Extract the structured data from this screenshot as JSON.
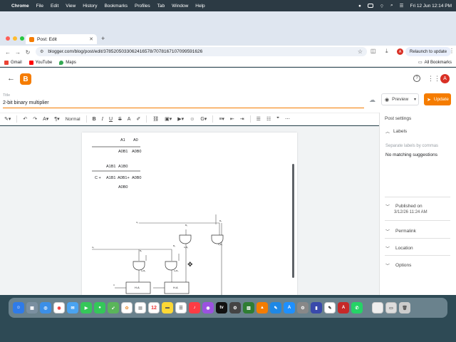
{
  "menubar": {
    "apple": "",
    "items": [
      "Chrome",
      "File",
      "Edit",
      "View",
      "History",
      "Bookmarks",
      "Profiles",
      "Tab",
      "Window",
      "Help"
    ],
    "clock": "Fri 12 Jun  12:14 PM"
  },
  "browser": {
    "tab_title": "Post: Edit",
    "url": "blogger.com/blog/post/edit/3785205033062416578/7078167107099591626",
    "relaunch": "Relaunch to update",
    "avatar_letter": "A",
    "bookmarks": [
      {
        "label": "Gmail"
      },
      {
        "label": "YouTube"
      },
      {
        "label": "Maps"
      }
    ],
    "all_bookmarks": "All Bookmarks"
  },
  "blogger": {
    "logo": "B",
    "avatar_letter": "A",
    "title_label": "Title",
    "title_value": "2-bit binary multiplier",
    "preview_label": "Preview",
    "update_label": "Update"
  },
  "toolbar": {
    "normal_label": "Normal"
  },
  "post_content": {
    "row1": [
      "A1",
      "A0"
    ],
    "row2": [
      "A0B1",
      "A0B0"
    ],
    "row3": [
      "A1B1",
      "A1B0"
    ],
    "row4_prefix": "C +",
    "row4": [
      "A1B1",
      "A0B1+",
      "A0B0"
    ],
    "row5": [
      "A0B0"
    ],
    "ha_label": "H.A"
  },
  "sidebar": {
    "title": "Post settings",
    "labels": "Labels",
    "labels_placeholder": "Separate labels by commas",
    "no_match": "No matching suggestions",
    "published_on": "Published on",
    "published_date": "3/12/26 11:24 AM",
    "permalink": "Permalink",
    "location": "Location",
    "options": "Options"
  },
  "colors": {
    "accent": "#f57c00",
    "menubar": "#2c3a44",
    "chrome_frame": "#dfe6f0"
  }
}
